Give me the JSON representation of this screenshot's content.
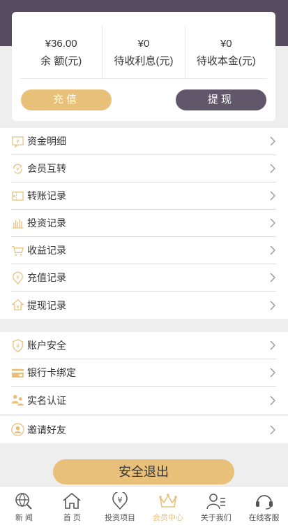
{
  "balance": {
    "stats": [
      {
        "value": "¥36.00",
        "label": "余 额(元)"
      },
      {
        "value": "¥0",
        "label": "待收利息(元)"
      },
      {
        "value": "¥0",
        "label": "待收本金(元)"
      }
    ],
    "recharge_label": "充值",
    "withdraw_label": "提现"
  },
  "menu_group1": [
    {
      "label": "资金明细",
      "icon": "fund-detail-icon"
    },
    {
      "label": "会员互转",
      "icon": "member-transfer-icon"
    },
    {
      "label": "转账记录",
      "icon": "transfer-record-icon"
    },
    {
      "label": "投资记录",
      "icon": "investment-record-icon"
    },
    {
      "label": "收益记录",
      "icon": "income-record-icon"
    },
    {
      "label": "充值记录",
      "icon": "recharge-record-icon"
    },
    {
      "label": "提现记录",
      "icon": "withdraw-record-icon"
    }
  ],
  "menu_group2": [
    {
      "label": "账户安全",
      "icon": "shield-icon"
    },
    {
      "label": "银行卡绑定",
      "icon": "bank-card-icon"
    },
    {
      "label": "实名认证",
      "icon": "users-icon"
    }
  ],
  "menu_group3": [
    {
      "label": "邀请好友",
      "icon": "invite-friend-icon"
    }
  ],
  "logout_label": "安全退出",
  "tabs": [
    {
      "label": "新 闻",
      "icon": "news-icon"
    },
    {
      "label": "首 页",
      "icon": "home-icon"
    },
    {
      "label": "投资项目",
      "icon": "invest-icon"
    },
    {
      "label": "会员中心",
      "icon": "crown-icon",
      "active": true
    },
    {
      "label": "关于我们",
      "icon": "about-icon"
    },
    {
      "label": "在线客服",
      "icon": "headset-icon"
    }
  ],
  "colors": {
    "accent": "#e8c07a",
    "header": "#574c5f",
    "withdraw": "#61576a"
  }
}
